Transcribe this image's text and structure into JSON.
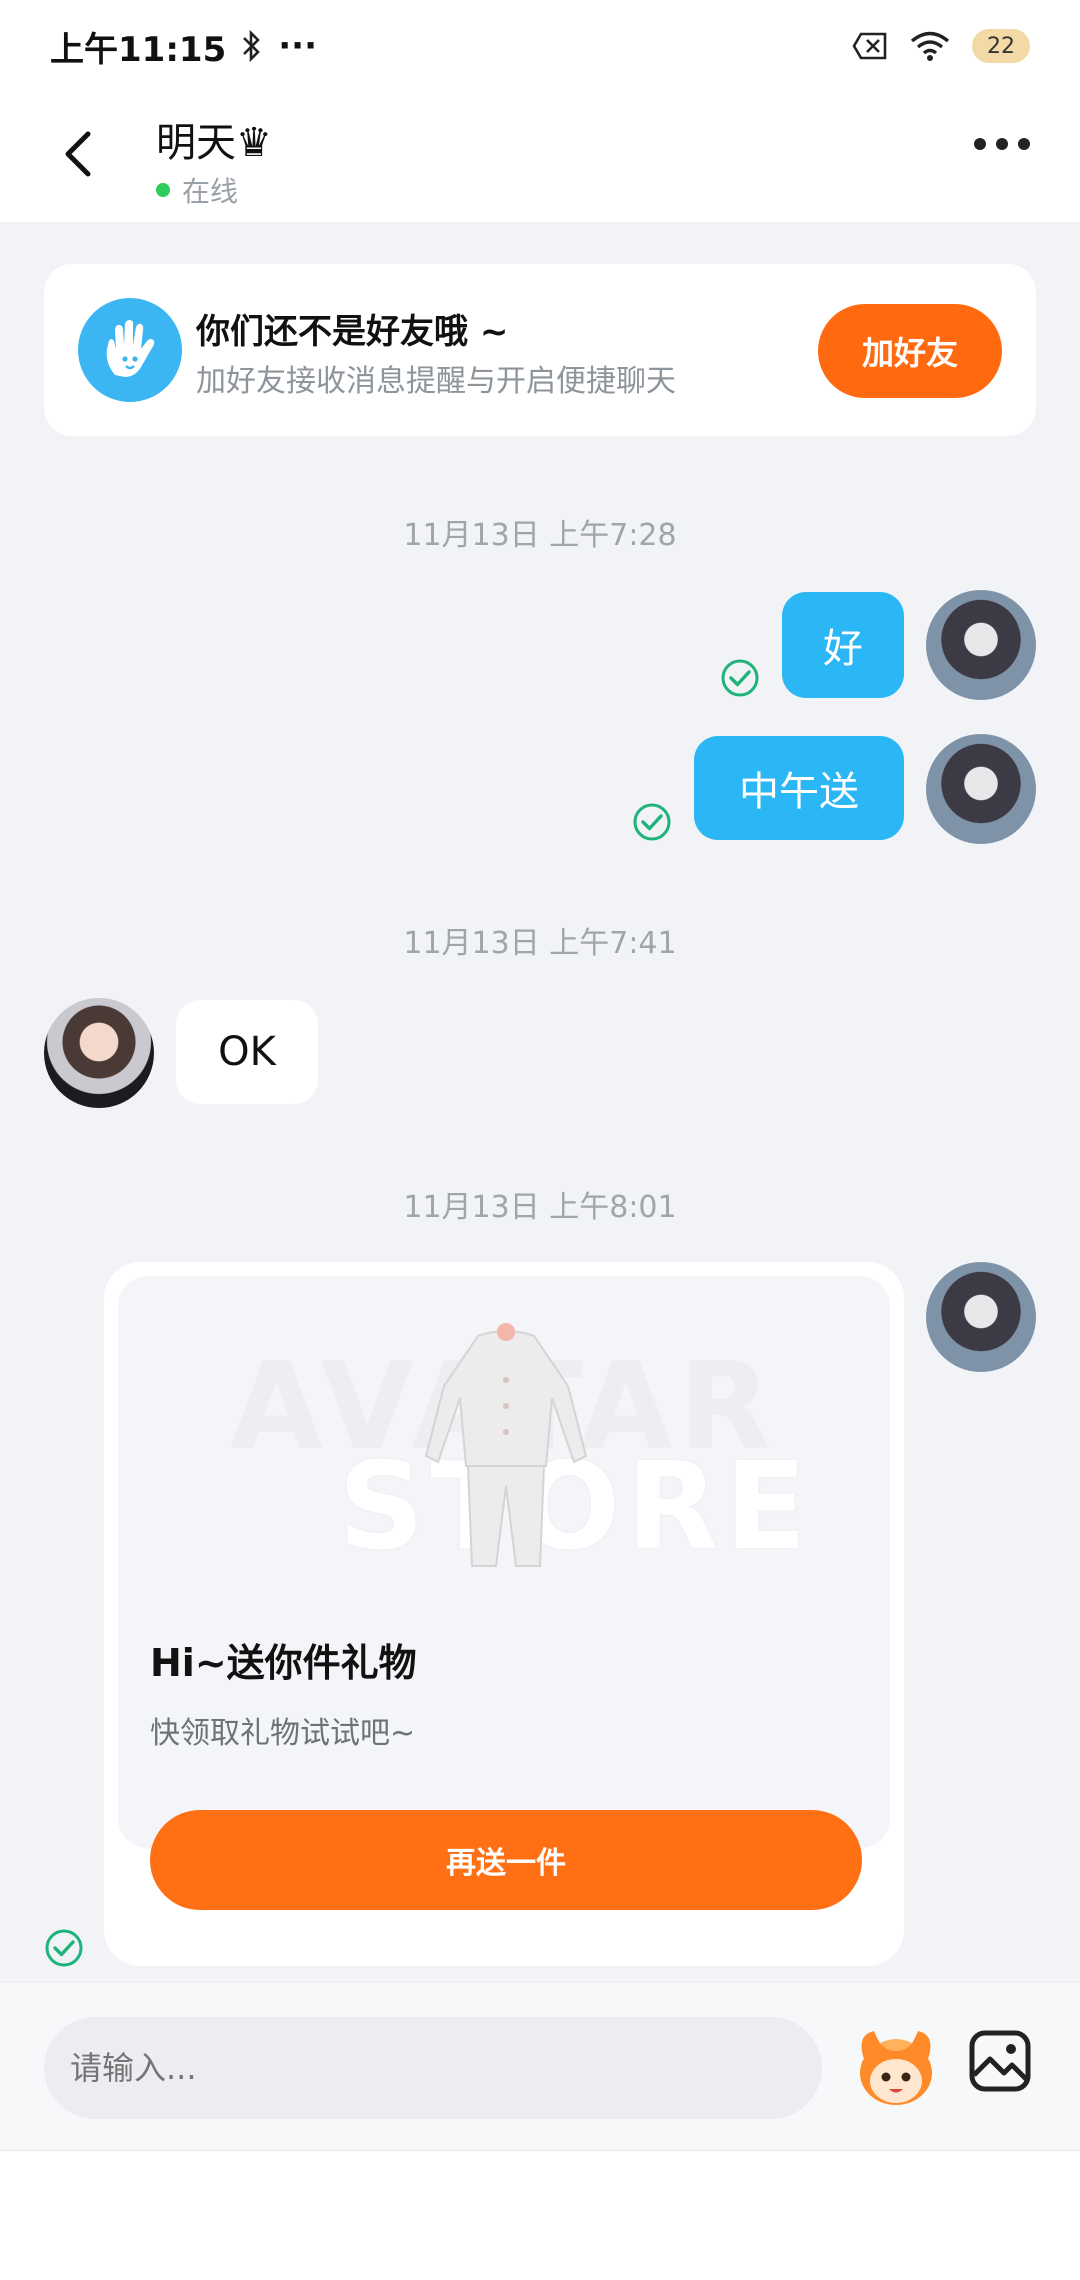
{
  "status_bar": {
    "time": "上午11:15",
    "more": "···",
    "battery": "22"
  },
  "header": {
    "title": "明天♛",
    "status": "在线"
  },
  "friend_banner": {
    "title": "你们还不是好友哦 ~",
    "subtitle": "加好友接收消息提醒与开启便捷聊天",
    "button_label": "加好友"
  },
  "messages": [
    {
      "timestamp": "11月13日 上午7:28"
    },
    {
      "text": "好"
    },
    {
      "text": "中午送"
    },
    {
      "timestamp": "11月13日 上午7:41"
    },
    {
      "text": "OK"
    },
    {
      "timestamp": "11月13日 上午8:01"
    }
  ],
  "gift_card": {
    "watermark_line1": "AVATAR",
    "watermark_line2": "STORE",
    "title": "Hi~送你件礼物",
    "subtitle": "快领取礼物试试吧~",
    "button_label": "再送一件"
  },
  "input_bar": {
    "placeholder": "请输入..."
  },
  "colors": {
    "accent_orange": "#ff6a10",
    "bubble_blue": "#2bb6f6",
    "online_green": "#2ecc5a",
    "check_green": "#1fb27a"
  }
}
